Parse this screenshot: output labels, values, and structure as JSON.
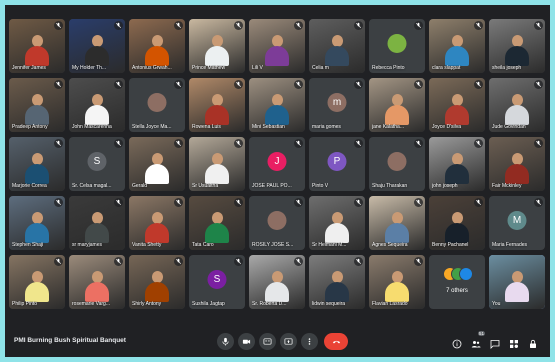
{
  "meeting": {
    "title": "PMI Burning Bush Spiritual Banquet"
  },
  "participants": [
    {
      "name": "Jennifer James",
      "kind": "video",
      "bg": "#6f5a45",
      "shirt": "#c0392b"
    },
    {
      "name": "My Holder Th...",
      "kind": "video",
      "bg": "#2a3d6b",
      "shirt": "#2c2c2c"
    },
    {
      "name": "Antonius Grwah...",
      "kind": "video",
      "bg": "#8d6a4f",
      "shirt": "#d35400"
    },
    {
      "name": "Prince Mathew",
      "kind": "video",
      "bg": "#c9b8a0",
      "shirt": "#ecf0f1"
    },
    {
      "name": "Lili V",
      "kind": "video",
      "bg": "#9a8a7a",
      "shirt": "#7d3c98"
    },
    {
      "name": "Celia m",
      "kind": "video",
      "bg": "#5e5e5e",
      "shirt": "#34495e"
    },
    {
      "name": "Rebecca Pinto",
      "kind": "avatar",
      "avatar_color": "#7cb342",
      "initial": ""
    },
    {
      "name": "clara slappat",
      "kind": "video",
      "bg": "#8e7f6b",
      "shirt": "#2e86c1"
    },
    {
      "name": "sheila joseph",
      "kind": "video",
      "bg": "#7a7a7a",
      "shirt": "#1c2833"
    },
    {
      "name": "Pradeep Antony",
      "kind": "video",
      "bg": "#6b5b4b",
      "shirt": "#566573"
    },
    {
      "name": "John Mascarenha",
      "kind": "video",
      "bg": "#4d4d4d",
      "shirt": "#f5f5f5"
    },
    {
      "name": "Stella Joyce Ma...",
      "kind": "avatar",
      "avatar_color": "#8d6e63",
      "initial": ""
    },
    {
      "name": "Rowena Luis",
      "kind": "video",
      "bg": "#b08968",
      "shirt": "#a93226"
    },
    {
      "name": "Mini Sebastian",
      "kind": "video",
      "bg": "#9c8f80",
      "shirt": "#1f618d"
    },
    {
      "name": "maria gomes",
      "kind": "avatar",
      "avatar_color": "#8d6e63",
      "initial": "m"
    },
    {
      "name": "jane Kalatha...",
      "kind": "video",
      "bg": "#a39584",
      "shirt": "#e59866"
    },
    {
      "name": "Joyce D'silva",
      "kind": "video",
      "bg": "#7b6a58",
      "shirt": "#b03a2e"
    },
    {
      "name": "Jude Govindan",
      "kind": "video",
      "bg": "#6e6e6e",
      "shirt": "#d5d8dc"
    },
    {
      "name": "Marjorie Correa",
      "kind": "video",
      "bg": "#55606b",
      "shirt": "#1b4f72"
    },
    {
      "name": "Sr. Celsa magal...",
      "kind": "avatar",
      "avatar_color": "#5f6368",
      "initial": "S"
    },
    {
      "name": "Gerald",
      "kind": "video",
      "bg": "#7a6a5a",
      "shirt": "#ffffff"
    },
    {
      "name": "Sr Usualtha",
      "kind": "video",
      "bg": "#b3a898",
      "shirt": "#f0f0f0"
    },
    {
      "name": "JOSE PAUL PO...",
      "kind": "avatar",
      "avatar_color": "#e91e63",
      "initial": "J"
    },
    {
      "name": "Pinto V",
      "kind": "avatar",
      "avatar_color": "#7e57c2",
      "initial": "P"
    },
    {
      "name": "Shaju Tharakan",
      "kind": "avatar",
      "avatar_color": "#8d6e63",
      "initial": ""
    },
    {
      "name": "john joseph",
      "kind": "video",
      "bg": "#9a9a9a",
      "shirt": "#212f3c"
    },
    {
      "name": "Fair Mckinley",
      "kind": "video",
      "bg": "#6b5e52",
      "shirt": "#922b21"
    },
    {
      "name": "Stephen Shaji",
      "kind": "video",
      "bg": "#5d6d7e",
      "shirt": "#2874a6"
    },
    {
      "name": "sr maryjames",
      "kind": "video",
      "bg": "#3a3a3a",
      "shirt": "#424949"
    },
    {
      "name": "Vanita Shetty",
      "kind": "video",
      "bg": "#8b7765",
      "shirt": "#c0392b"
    },
    {
      "name": "Tata Caro",
      "kind": "video",
      "bg": "#574b40",
      "shirt": "#1e8449"
    },
    {
      "name": "ROSILY JOSE S...",
      "kind": "avatar",
      "avatar_color": "#8d6e63",
      "initial": ""
    },
    {
      "name": "Sr Helmani M...",
      "kind": "video",
      "bg": "#6e6e6e",
      "shirt": "#efefef"
    },
    {
      "name": "Agnes Sequeira",
      "kind": "video",
      "bg": "#c8bba8",
      "shirt": "#5b7fa6"
    },
    {
      "name": "Benny Pachanel",
      "kind": "video",
      "bg": "#4b4038",
      "shirt": "#17202a"
    },
    {
      "name": "Maria Fernades",
      "kind": "avatar",
      "avatar_color": "#5f8a8b",
      "initial": "M"
    },
    {
      "name": "Philip Pinto",
      "kind": "video",
      "bg": "#857462",
      "shirt": "#f0e68c"
    },
    {
      "name": "rosemarie Varg...",
      "kind": "video",
      "bg": "#9b8b7b",
      "shirt": "#ec7063"
    },
    {
      "name": "Shirly Antony",
      "kind": "video",
      "bg": "#766656",
      "shirt": "#a04000"
    },
    {
      "name": "Sushila Jagtap",
      "kind": "avatar",
      "avatar_color": "#7b1fa2",
      "initial": "S"
    },
    {
      "name": "Sr. Roberta D...",
      "kind": "video",
      "bg": "#a9a9a9",
      "shirt": "#e5e7e9"
    },
    {
      "name": "lidwin sequeira",
      "kind": "video",
      "bg": "#7d7d7d",
      "shirt": "#283747"
    },
    {
      "name": "Flavian Lasrado",
      "kind": "video",
      "bg": "#8a7b6c",
      "shirt": "#f7dc6f"
    }
  ],
  "others": {
    "label": "7 others",
    "colors": [
      "#f9a825",
      "#43a047",
      "#1e88e5"
    ]
  },
  "self_tile": {
    "name": "You",
    "bg": "#6b8ea0",
    "shirt": "#e8daef"
  },
  "controls": [
    "mic-icon",
    "camera-icon",
    "captions-icon",
    "present-icon",
    "more-icon",
    "end-call-icon"
  ],
  "right_controls": {
    "participants_count": "51"
  }
}
